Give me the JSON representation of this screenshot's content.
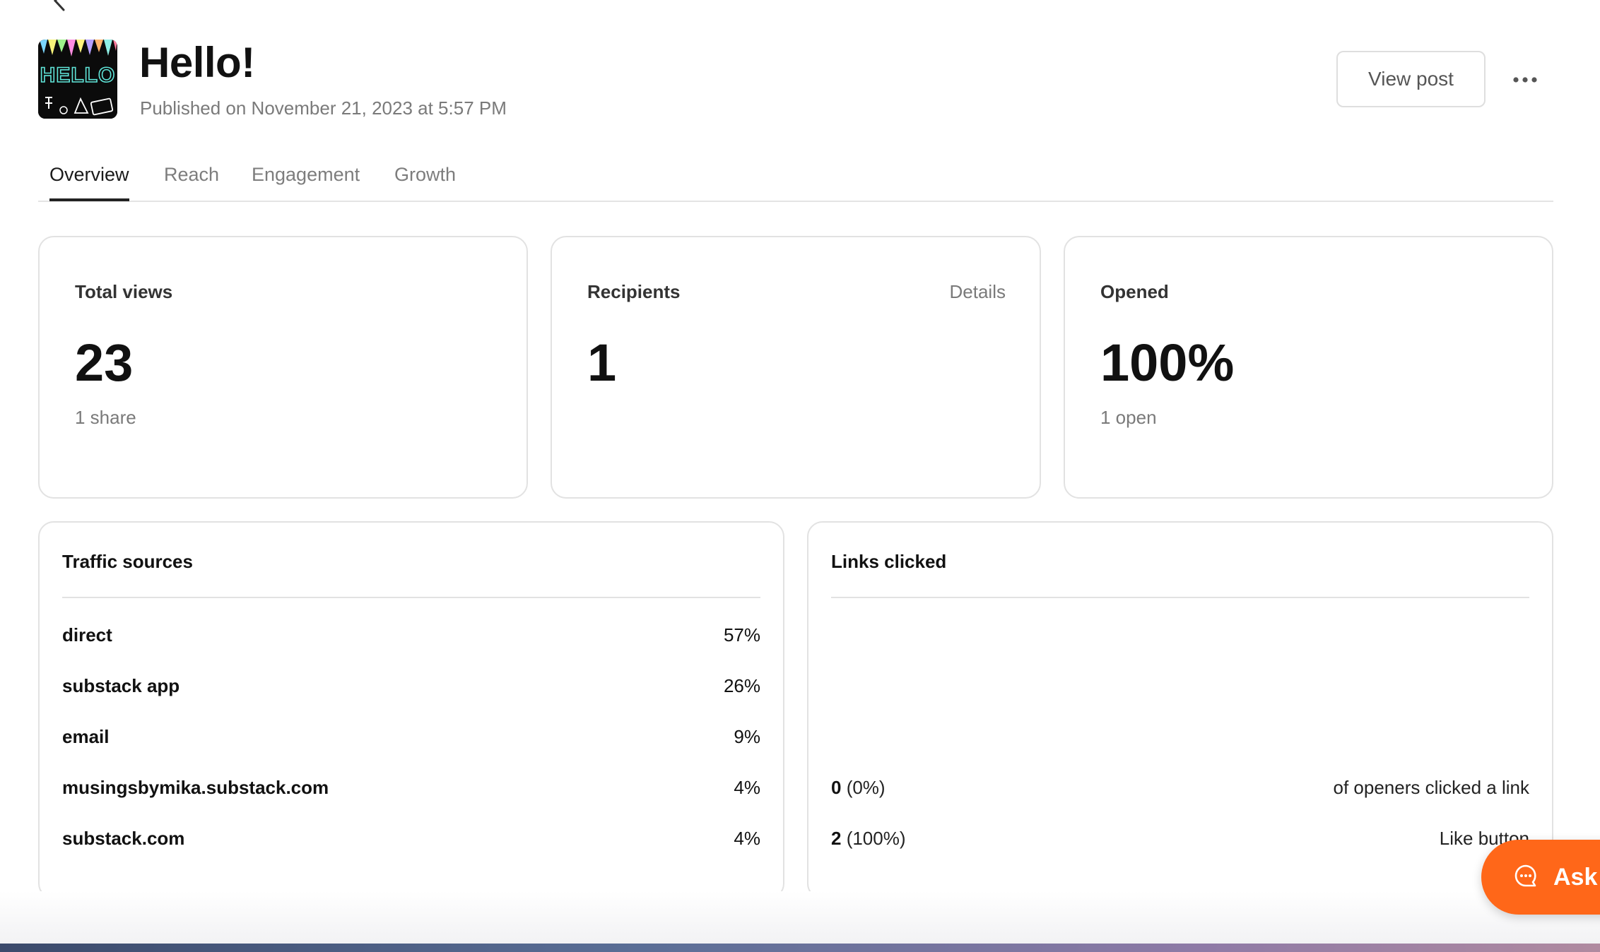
{
  "post": {
    "title": "Hello!",
    "published": "Published on November 21, 2023 at 5:57 PM",
    "thumbnail_text": "HELLO"
  },
  "header": {
    "view_post_label": "View post",
    "back_icon": "chevron-left-icon",
    "more_icon": "ellipsis-icon"
  },
  "tabs": [
    {
      "label": "Overview",
      "active": true
    },
    {
      "label": "Reach",
      "active": false
    },
    {
      "label": "Engagement",
      "active": false
    },
    {
      "label": "Growth",
      "active": false
    }
  ],
  "stats": {
    "total_views": {
      "label": "Total views",
      "value": "23",
      "sub": "1 share"
    },
    "recipients": {
      "label": "Recipients",
      "value": "1",
      "details_label": "Details"
    },
    "opened": {
      "label": "Opened",
      "value": "100%",
      "sub": "1 open"
    }
  },
  "traffic_sources": {
    "title": "Traffic sources",
    "rows": [
      {
        "name": "direct",
        "pct": "57%"
      },
      {
        "name": "substack app",
        "pct": "26%"
      },
      {
        "name": "email",
        "pct": "9%"
      },
      {
        "name": "musingsbymika.substack.com",
        "pct": "4%"
      },
      {
        "name": "substack.com",
        "pct": "4%"
      }
    ]
  },
  "links_clicked": {
    "title": "Links clicked",
    "rows": [
      {
        "count": "0",
        "pct": " (0%)",
        "desc": "of openers clicked a link"
      },
      {
        "count": "2",
        "pct": " (100%)",
        "desc": "Like button"
      }
    ]
  },
  "ask": {
    "label": "Ask",
    "icon": "chat-bubble-icon"
  },
  "colors": {
    "accent": "#ff6719",
    "border": "#e2e2e2",
    "muted": "#7a7a7a"
  }
}
